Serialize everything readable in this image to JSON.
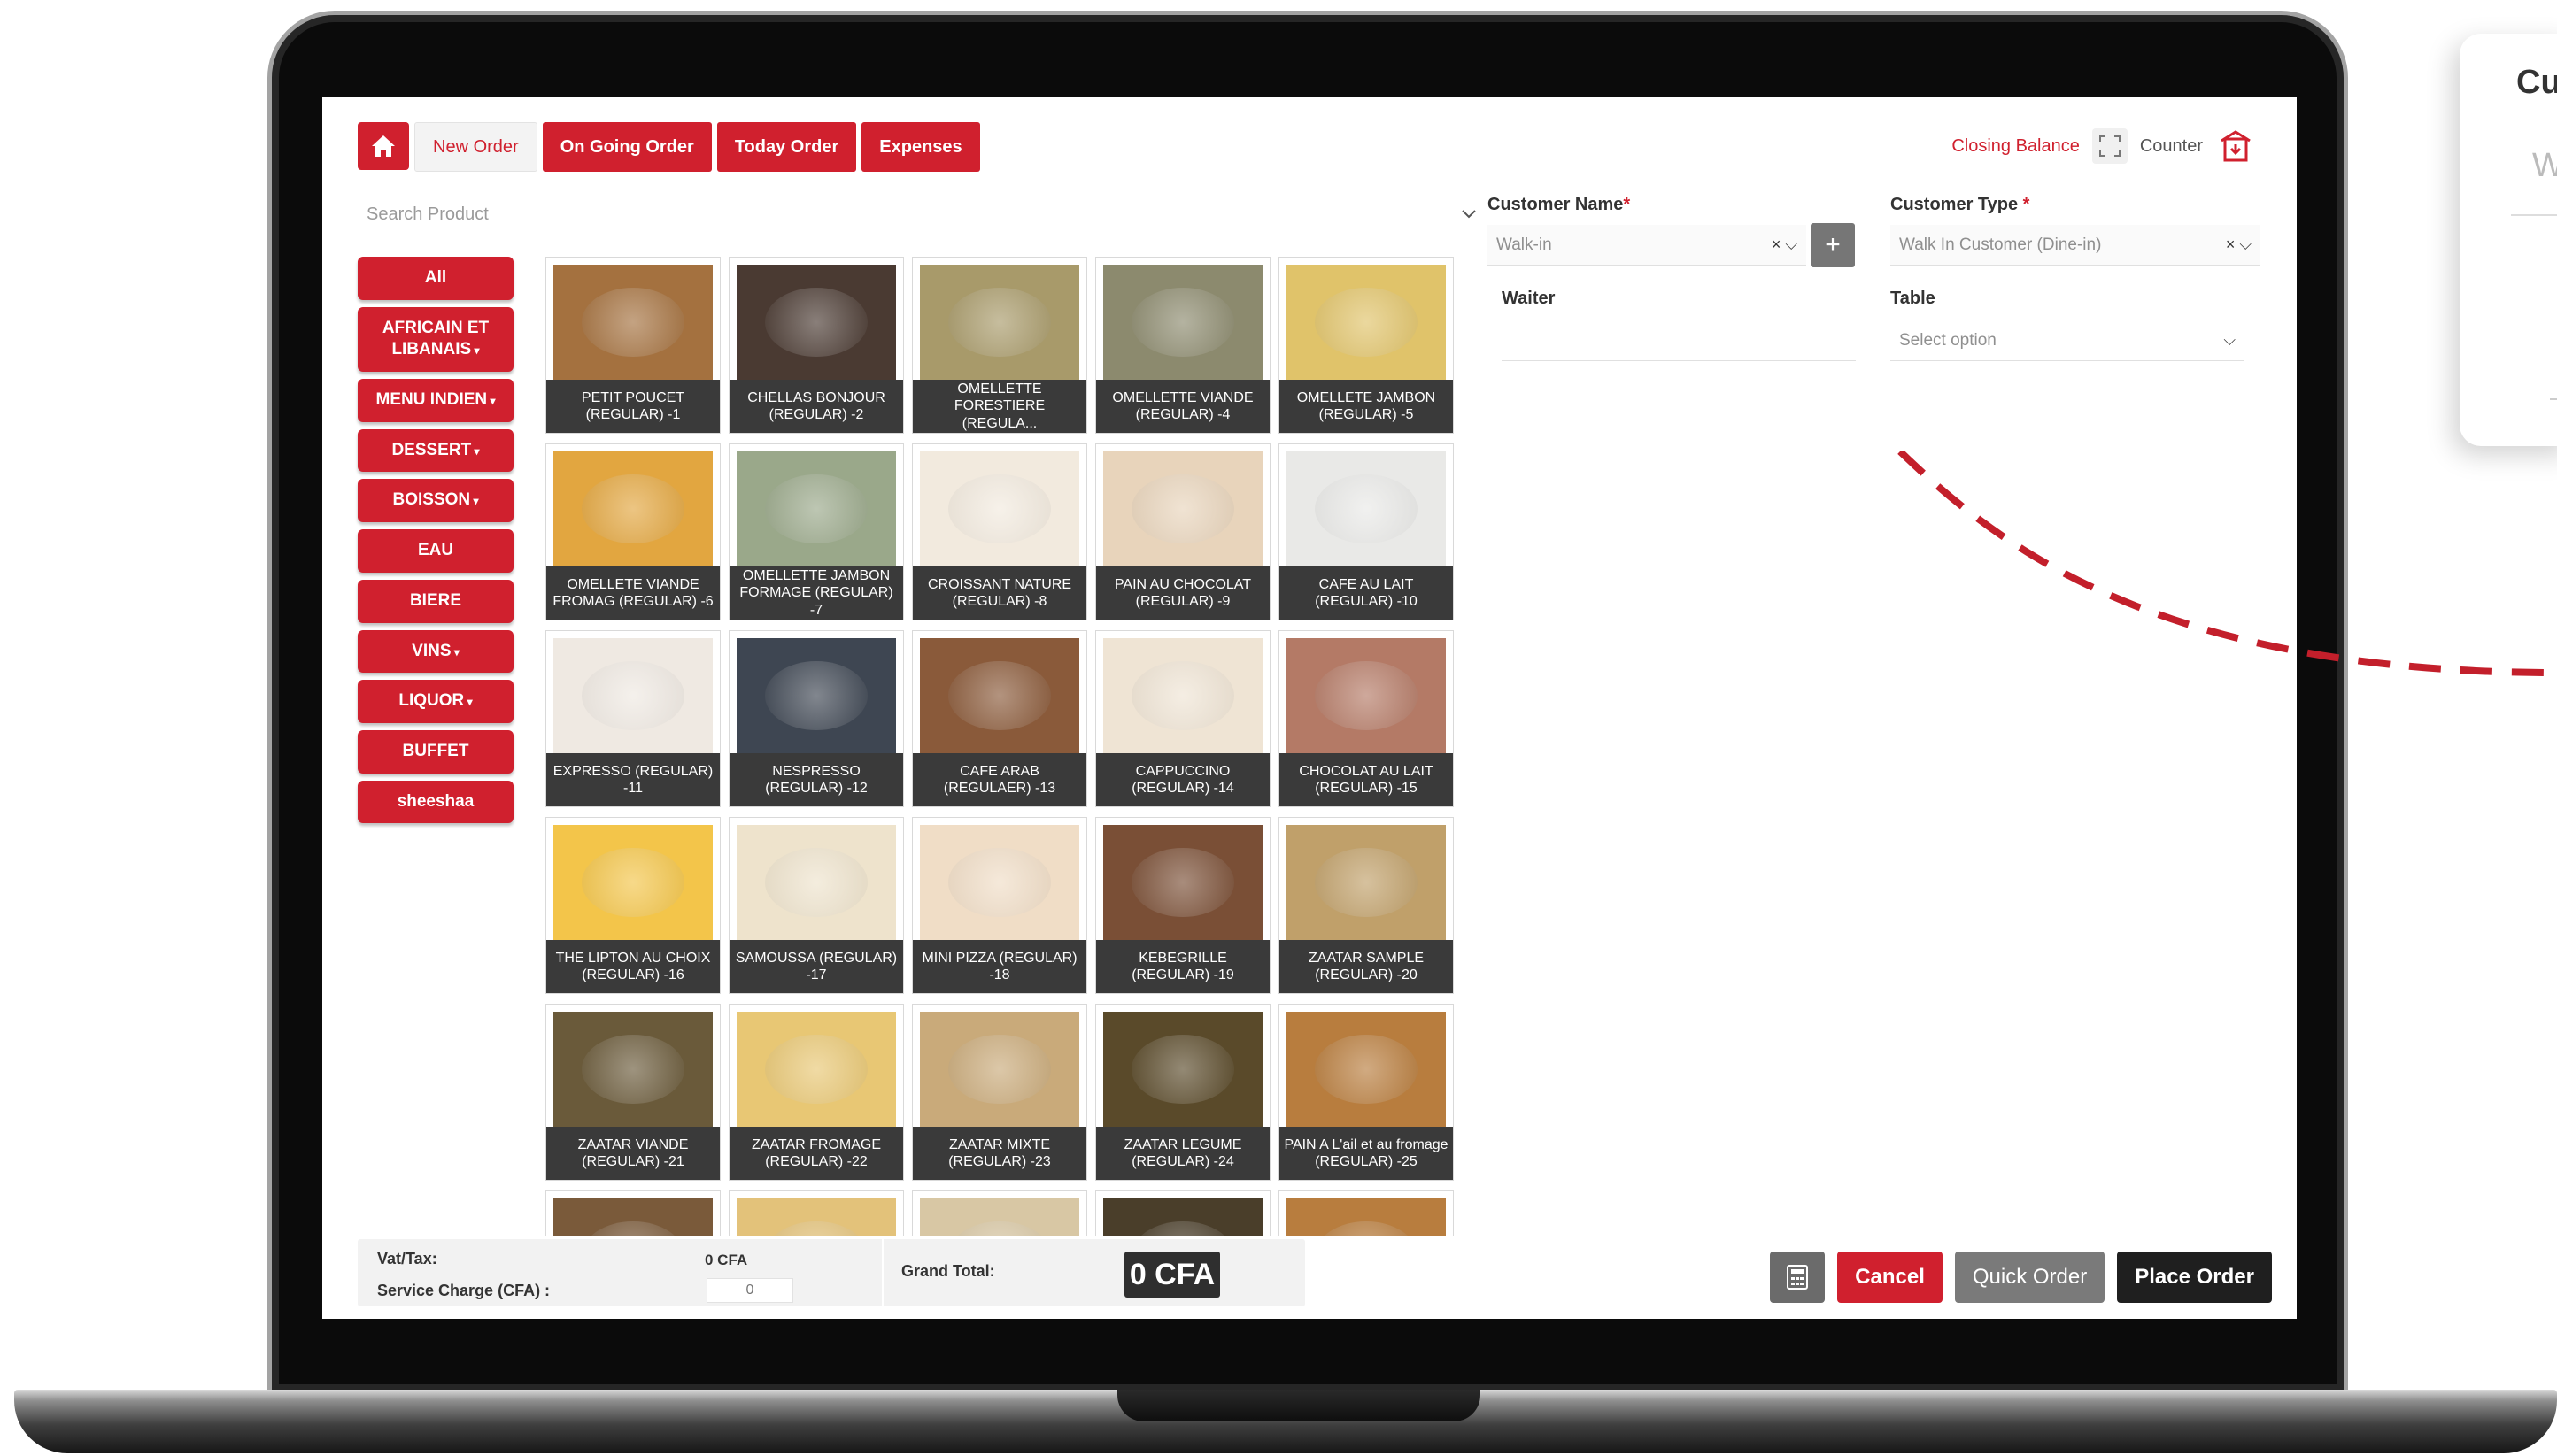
{
  "nav": {
    "tabs": [
      {
        "label": "New Order"
      },
      {
        "label": "On Going Order"
      },
      {
        "label": "Today Order"
      },
      {
        "label": "Expenses"
      }
    ],
    "closing_balance": "Closing Balance",
    "counter": "Counter"
  },
  "search": {
    "placeholder": "Search Product"
  },
  "categories": [
    {
      "label": "All",
      "dropdown": false
    },
    {
      "label": "AFRICAIN ET LIBANAIS",
      "dropdown": true
    },
    {
      "label": "MENU INDIEN",
      "dropdown": true
    },
    {
      "label": "DESSERT",
      "dropdown": true
    },
    {
      "label": "BOISSON",
      "dropdown": true
    },
    {
      "label": "EAU",
      "dropdown": false
    },
    {
      "label": "BIERE",
      "dropdown": false
    },
    {
      "label": "VINS",
      "dropdown": true
    },
    {
      "label": "LIQUOR",
      "dropdown": true
    },
    {
      "label": "BUFFET",
      "dropdown": false
    },
    {
      "label": "sheeshaa",
      "dropdown": false
    }
  ],
  "products": [
    {
      "name": "PETIT POUCET (REGULAR) -1",
      "color": "#a4713f"
    },
    {
      "name": "CHELLAS BONJOUR (REGULAR) -2",
      "color": "#4a3a32"
    },
    {
      "name": "OMELLETTE FORESTIERE (REGULA...",
      "color": "#a89a6a"
    },
    {
      "name": "OMELLETTE VIANDE (REGULAR) -4",
      "color": "#8c8a6e"
    },
    {
      "name": "OMELLETE JAMBON (REGULAR) -5",
      "color": "#e0c36a"
    },
    {
      "name": "OMELLETE VIANDE FROMAG (REGULAR) -6",
      "color": "#e2a640"
    },
    {
      "name": "OMELLETTE JAMBON FORMAGE (REGULAR) -7",
      "color": "#9aa88a"
    },
    {
      "name": "CROISSANT NATURE (REGULAR) -8",
      "color": "#f2eade"
    },
    {
      "name": "PAIN AU CHOCOLAT (REGULAR) -9",
      "color": "#e8d4bb"
    },
    {
      "name": "CAFE AU LAIT (REGULAR) -10",
      "color": "#e9e9e7"
    },
    {
      "name": "EXPRESSO (REGULAR) -11",
      "color": "#efe9e2"
    },
    {
      "name": "NESPRESSO (REGULAR) -12",
      "color": "#3e4652"
    },
    {
      "name": "CAFE ARAB (REGULAER) -13",
      "color": "#8a5a3a"
    },
    {
      "name": "CAPPUCCINO (REGULAR) -14",
      "color": "#efe4d4"
    },
    {
      "name": "CHOCOLAT AU LAIT (REGULAR) -15",
      "color": "#b47a66"
    },
    {
      "name": "THE LIPTON AU CHOIX (REGULAR) -16",
      "color": "#f3c54a"
    },
    {
      "name": "SAMOUSSA (REGULAR) -17",
      "color": "#eee3cc"
    },
    {
      "name": "MINI PIZZA (REGULAR) -18",
      "color": "#f0ddc6"
    },
    {
      "name": "KEBEGRILLE (REGULAR) -19",
      "color": "#7a4f36"
    },
    {
      "name": "ZAATAR SAMPLE (REGULAR) -20",
      "color": "#c0a06a"
    },
    {
      "name": "ZAATAR VIANDE (REGULAR) -21",
      "color": "#6a5a3a"
    },
    {
      "name": "ZAATAR FROMAGE (REGULAR) -22",
      "color": "#e8c774"
    },
    {
      "name": "ZAATAR MIXTE (REGULAR) -23",
      "color": "#c9aa7a"
    },
    {
      "name": "ZAATAR LEGUME (REGULAR) -24",
      "color": "#5a4a2a"
    },
    {
      "name": "PAIN A L'ail et au fromage (REGULAR) -25",
      "color": "#b87d3e"
    },
    {
      "name": "",
      "color": "#7a5a3a"
    },
    {
      "name": "",
      "color": "#e3c27a"
    },
    {
      "name": "",
      "color": "#d8c7a4"
    },
    {
      "name": "",
      "color": "#4a3e2a"
    },
    {
      "name": "",
      "color": "#b87d3e"
    }
  ],
  "form": {
    "customer_name_label": "Customer Name",
    "customer_name_value": "Walk-in",
    "customer_type_label": "Customer Type",
    "customer_type_value": "Walk In Customer (Dine-in)",
    "waiter_label": "Waiter",
    "table_label": "Table",
    "table_placeholder": "Select option",
    "required_mark": "*",
    "clear_glyph": "×",
    "add_glyph": "+"
  },
  "footer": {
    "vat_label": "Vat/Tax:",
    "vat_value": "0 CFA",
    "service_label": "Service Charge (CFA) :",
    "service_value": "0",
    "grand_total_label": "Grand Total:",
    "grand_total_value": "0 CFA"
  },
  "actions": {
    "cancel": "Cancel",
    "quick_order": "Quick Order",
    "place_order": "Place Order"
  },
  "overlay": {
    "title": "Cu",
    "field_text": "W"
  },
  "colors": {
    "primary": "#d0202e",
    "dark": "#3a3a3a"
  }
}
